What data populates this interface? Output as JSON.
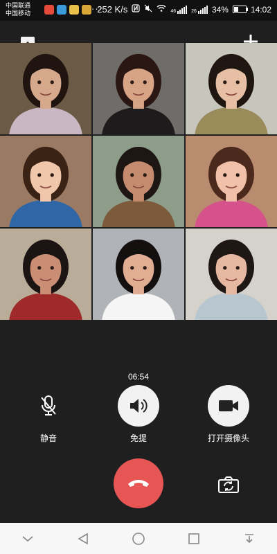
{
  "status_bar": {
    "carrier_1": "中国联通",
    "carrier_2": "中国移动",
    "net_speed": "252 K/s",
    "network_label": "46",
    "network_label_2": "26",
    "battery": "34%",
    "time": "14:02",
    "notification_icons": [
      "app-icon-1",
      "app-icon-2",
      "app-icon-3",
      "app-icon-4"
    ],
    "overflow": "···"
  },
  "call": {
    "duration": "06:54",
    "controls": {
      "mute_label": "静音",
      "speaker_label": "免提",
      "camera_label": "打开摄像头"
    }
  },
  "participants": [
    {
      "id": "p1",
      "bg": "#6a5a46",
      "shirt": "#c9b7c4",
      "skin": "#d6a98c",
      "hair": "#1f1410"
    },
    {
      "id": "p2",
      "bg": "#6f6d69",
      "shirt": "#1f1a1b",
      "skin": "#d7a585",
      "hair": "#2a1714"
    },
    {
      "id": "p3",
      "bg": "#c7c6bd",
      "shirt": "#9a8b5b",
      "skin": "#e6bfa4",
      "hair": "#1f1612"
    },
    {
      "id": "p4",
      "bg": "#9b7a63",
      "shirt": "#2f66a6",
      "skin": "#f0c7aa",
      "hair": "#3a2214"
    },
    {
      "id": "p5",
      "bg": "#8e9c8a",
      "shirt": "#7e5a3d",
      "skin": "#c48b6f",
      "hair": "#1e1612"
    },
    {
      "id": "p6",
      "bg": "#b98b6f",
      "shirt": "#d6528a",
      "skin": "#f0c0a8",
      "hair": "#4b2a1d"
    },
    {
      "id": "p7",
      "bg": "#b9ad9a",
      "shirt": "#9f2a2a",
      "skin": "#c98e73",
      "hair": "#1b1412"
    },
    {
      "id": "p8",
      "bg": "#b0b3b7",
      "shirt": "#f5f5f5",
      "skin": "#e1ad93",
      "hair": "#141010"
    },
    {
      "id": "p9",
      "bg": "#d5d2cc",
      "shirt": "#b7c6cf",
      "skin": "#e6b8a1",
      "hair": "#1e1714"
    }
  ],
  "colors": {
    "hangup": "#e85555",
    "control_bg": "#f2f2f2",
    "background": "#1f1f1f"
  }
}
